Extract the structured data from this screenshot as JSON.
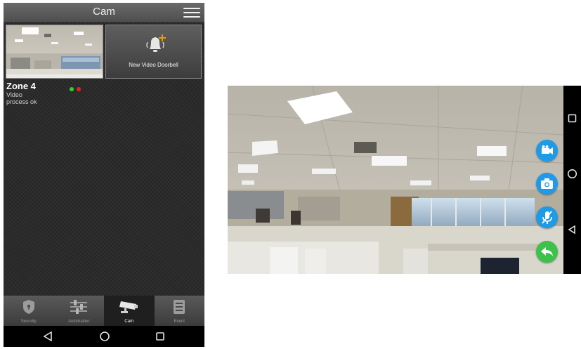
{
  "header": {
    "title": "Cam",
    "menu_icon": "hamburger-menu-icon"
  },
  "tiles": {
    "camera_preview": {
      "kind": "office-camera-thumbnail"
    },
    "add_device": {
      "label": "New Video Doorbell",
      "icon": "doorbell-plus-icon"
    }
  },
  "zone": {
    "name": "Zone 4",
    "line1": "Video",
    "line2": "process ok"
  },
  "status_dots": {
    "green": "#2bd62b",
    "red": "#e52222"
  },
  "tabs": [
    {
      "label": "Security",
      "icon": "shield-icon",
      "active": false
    },
    {
      "label": "Automation",
      "icon": "sliders-icon",
      "active": false
    },
    {
      "label": "Cam",
      "icon": "cctv-camera-icon",
      "active": true
    },
    {
      "label": "Event",
      "icon": "event-list-icon",
      "active": false
    }
  ],
  "system_nav": {
    "back": "back-icon",
    "home": "home-icon",
    "recents": "recents-icon"
  },
  "landscape": {
    "controls": [
      {
        "name": "record-video-button",
        "icon": "video-camera-icon",
        "color": "#1e9be8"
      },
      {
        "name": "snapshot-button",
        "icon": "camera-icon",
        "color": "#1e9be8"
      },
      {
        "name": "mute-mic-button",
        "icon": "microphone-off-icon",
        "color": "#1e9be8"
      },
      {
        "name": "back-button",
        "icon": "reply-arrow-icon",
        "color": "#3cc24a"
      }
    ]
  }
}
